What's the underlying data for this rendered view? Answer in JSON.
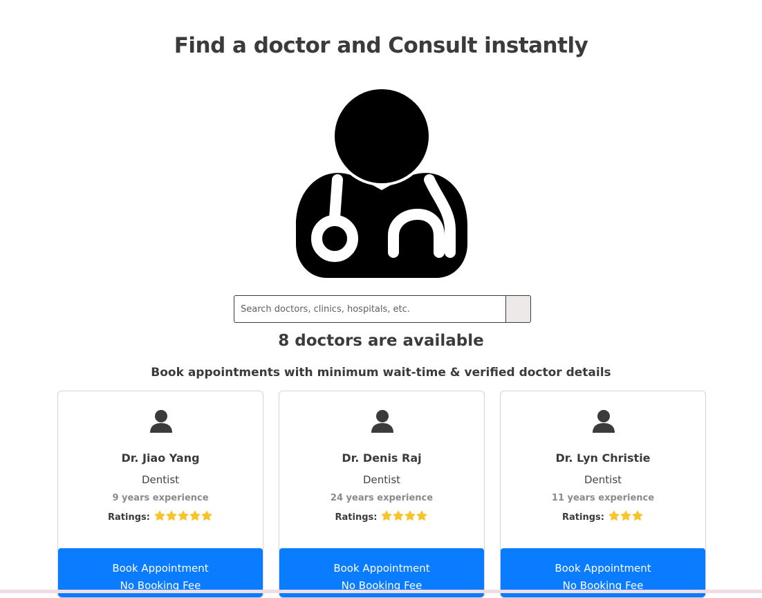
{
  "page": {
    "title": "Find a doctor and Consult instantly",
    "available_text": "8 doctors are available",
    "subtitle": "Book appointments with minimum wait-time & verified doctor details"
  },
  "search": {
    "placeholder": "Search doctors, clinics, hospitals, etc.",
    "value": ""
  },
  "ratings_label": "Ratings:",
  "doctors": [
    {
      "name": "Dr. Jiao Yang",
      "specialty": "Dentist",
      "experience": "9 years experience",
      "rating": 5,
      "book_label": "Book Appointment",
      "fee_label": "No Booking Fee"
    },
    {
      "name": "Dr. Denis Raj",
      "specialty": "Dentist",
      "experience": "24 years experience",
      "rating": 4,
      "book_label": "Book Appointment",
      "fee_label": "No Booking Fee"
    },
    {
      "name": "Dr. Lyn Christie",
      "specialty": "Dentist",
      "experience": "11 years experience",
      "rating": 3,
      "book_label": "Book Appointment",
      "fee_label": "No Booking Fee"
    }
  ],
  "icons": {
    "hero": "doctor-stethoscope-icon",
    "avatar": "user-avatar-icon",
    "star": "star-icon",
    "search": "search-icon"
  },
  "colors": {
    "primary_button": "#0a7cff",
    "star": "#f7c42b",
    "heading": "#3b3b3b"
  }
}
